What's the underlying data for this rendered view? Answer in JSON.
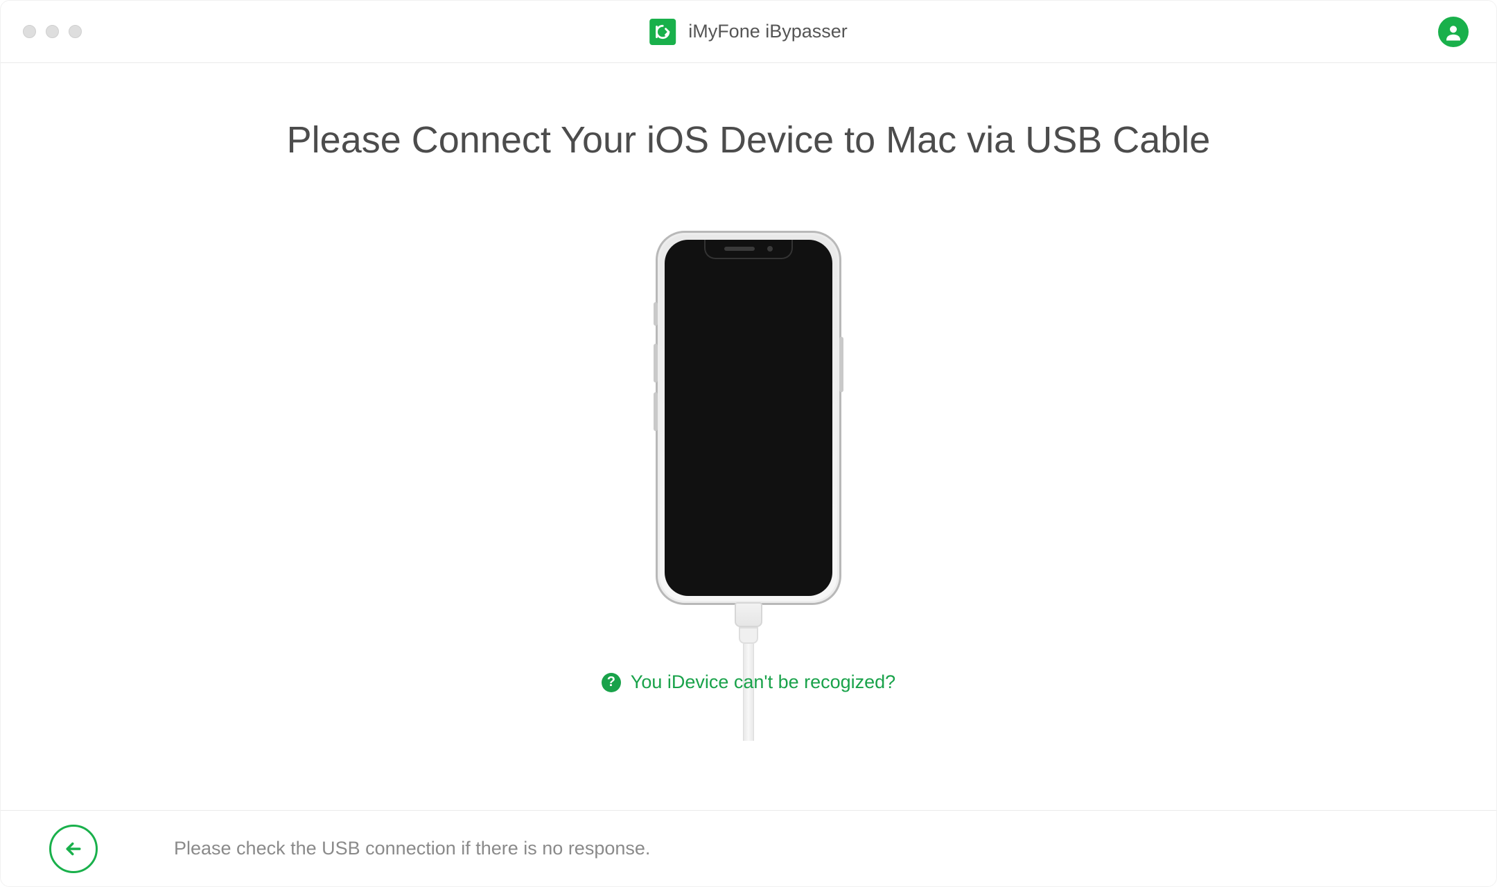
{
  "titlebar": {
    "app_title": "iMyFone iBypasser"
  },
  "main": {
    "heading": "Please Connect Your iOS Device to Mac via USB Cable",
    "help_label": "You iDevice can't be recogized?",
    "help_badge": "?"
  },
  "footer": {
    "hint": "Please check the USB connection if there is no response."
  },
  "colors": {
    "accent": "#19b04b"
  }
}
